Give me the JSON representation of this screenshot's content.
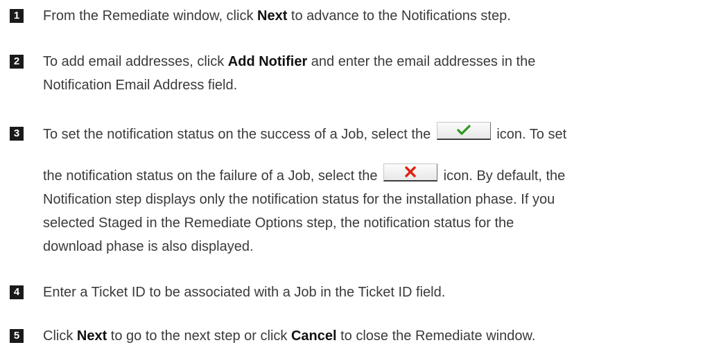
{
  "steps": [
    {
      "number": "1",
      "pre": "From the Remediate window, click ",
      "bold": "Next",
      "post": " to advance to the Notifications step."
    },
    {
      "number": "2",
      "pre": "To add email addresses, click ",
      "bold": "Add Notifier",
      "post": " and enter the email addresses in the",
      "line2": "Notification Email Address field."
    },
    {
      "number": "3",
      "line1_pre": "To set the notification status on the success of a Job, select the ",
      "line1_post": " icon. To set",
      "line2_pre": "the notification status on the failure of a Job, select the ",
      "line2_post": " icon. By default, the",
      "line3": "Notification step displays only the notification status for the installation phase. If you",
      "line4": "selected Staged in the Remediate Options step, the notification status for the",
      "line5": "download phase is also displayed.",
      "success_icon": "checkmark-icon",
      "failure_icon": "x-icon",
      "success_color": "#2a9a1a",
      "failure_color": "#e02010"
    },
    {
      "number": "4",
      "text": "Enter a Ticket ID to be associated with a Job in the Ticket ID field."
    },
    {
      "number": "5",
      "pre": "Click ",
      "bold1": "Next",
      "mid": " to go to the next step or click ",
      "bold2": "Cancel",
      "post": " to close the Remediate window."
    }
  ]
}
